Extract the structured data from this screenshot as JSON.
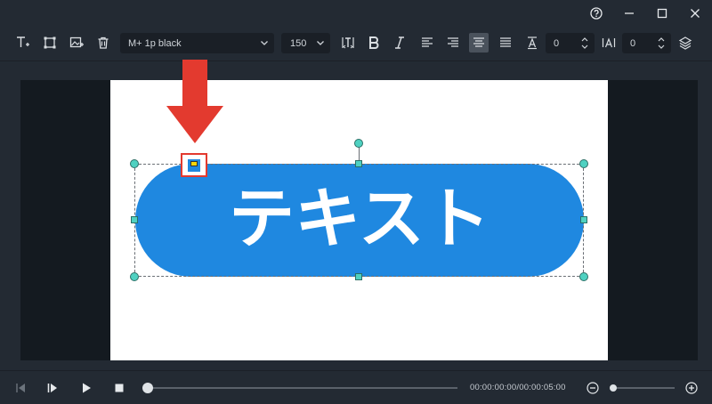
{
  "window": {
    "help_icon": "help-circle-icon",
    "minimize_icon": "minimize-icon",
    "maximize_icon": "maximize-icon",
    "close_icon": "close-icon"
  },
  "toolbar": {
    "font_family": "M+ 1p black",
    "font_size": "150",
    "line_spacing_value": "0",
    "letter_spacing_value": "0",
    "active_alignment": "center"
  },
  "canvas": {
    "text": "テキスト",
    "pill_color": "#1f88e0",
    "selection_handle_color": "#4fd1c1",
    "highlight_color": "#e33a2f"
  },
  "transport": {
    "timecode": "00:00:00:00/00:00:05:00"
  }
}
